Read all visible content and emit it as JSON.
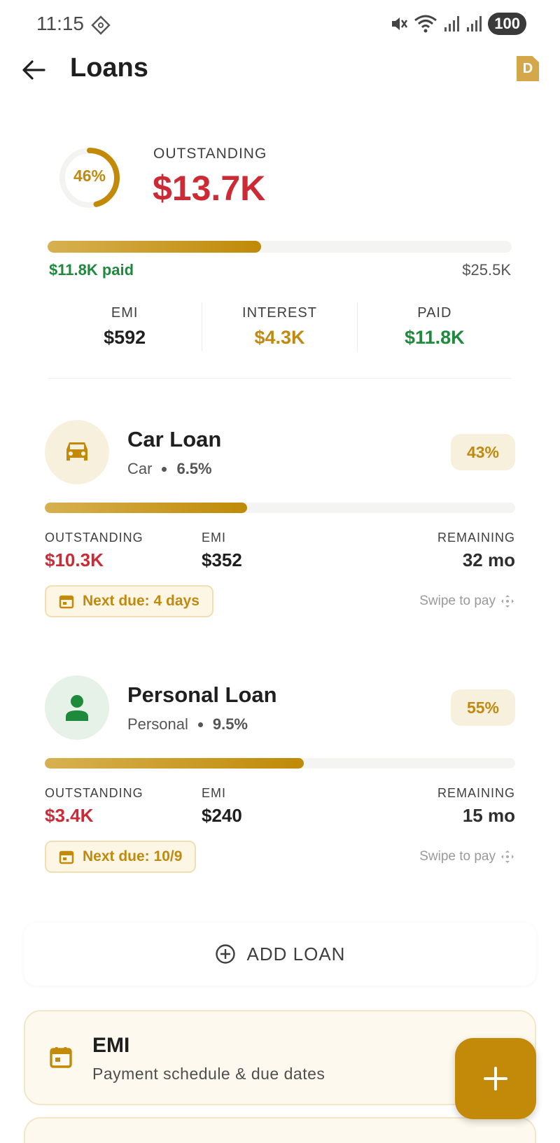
{
  "status_bar": {
    "time": "11:15",
    "battery": "100"
  },
  "header": {
    "title": "Loans",
    "doc_badge": "D"
  },
  "summary": {
    "percent_paid_label": "46%",
    "percent_paid": 0.46,
    "outstanding_label": "OUTSTANDING",
    "outstanding_value": "$13.7K",
    "paid_text": "$11.8K paid",
    "total_text": "$25.5K",
    "stats": [
      {
        "label": "EMI",
        "value": "$592"
      },
      {
        "label": "INTEREST",
        "value": "$4.3K"
      },
      {
        "label": "PAID",
        "value": "$11.8K"
      }
    ]
  },
  "loans": [
    {
      "name": "Car Loan",
      "type": "Car",
      "rate": "6.5%",
      "percent_label": "43%",
      "percent": 0.43,
      "outstanding_label": "OUTSTANDING",
      "outstanding_value": "$10.3K",
      "emi_label": "EMI",
      "emi_value": "$352",
      "remaining_label": "REMAINING",
      "remaining_value": "32 mo",
      "next_due": "Next due: 4 days",
      "swipe_hint": "Swipe to pay",
      "icon": "car-icon"
    },
    {
      "name": "Personal Loan",
      "type": "Personal",
      "rate": "9.5%",
      "percent_label": "55%",
      "percent": 0.55,
      "outstanding_label": "OUTSTANDING",
      "outstanding_value": "$3.4K",
      "emi_label": "EMI",
      "emi_value": "$240",
      "remaining_label": "REMAINING",
      "remaining_value": "15 mo",
      "next_due": "Next due: 10/9",
      "swipe_hint": "Swipe to pay",
      "icon": "person-icon"
    }
  ],
  "add_loan": {
    "label": "ADD LOAN"
  },
  "emi_card": {
    "title": "EMI",
    "subtitle": "Payment schedule & due dates"
  },
  "colors": {
    "accent": "#c38a0a",
    "negative": "#cc2b36",
    "positive": "#1e8a3c"
  }
}
